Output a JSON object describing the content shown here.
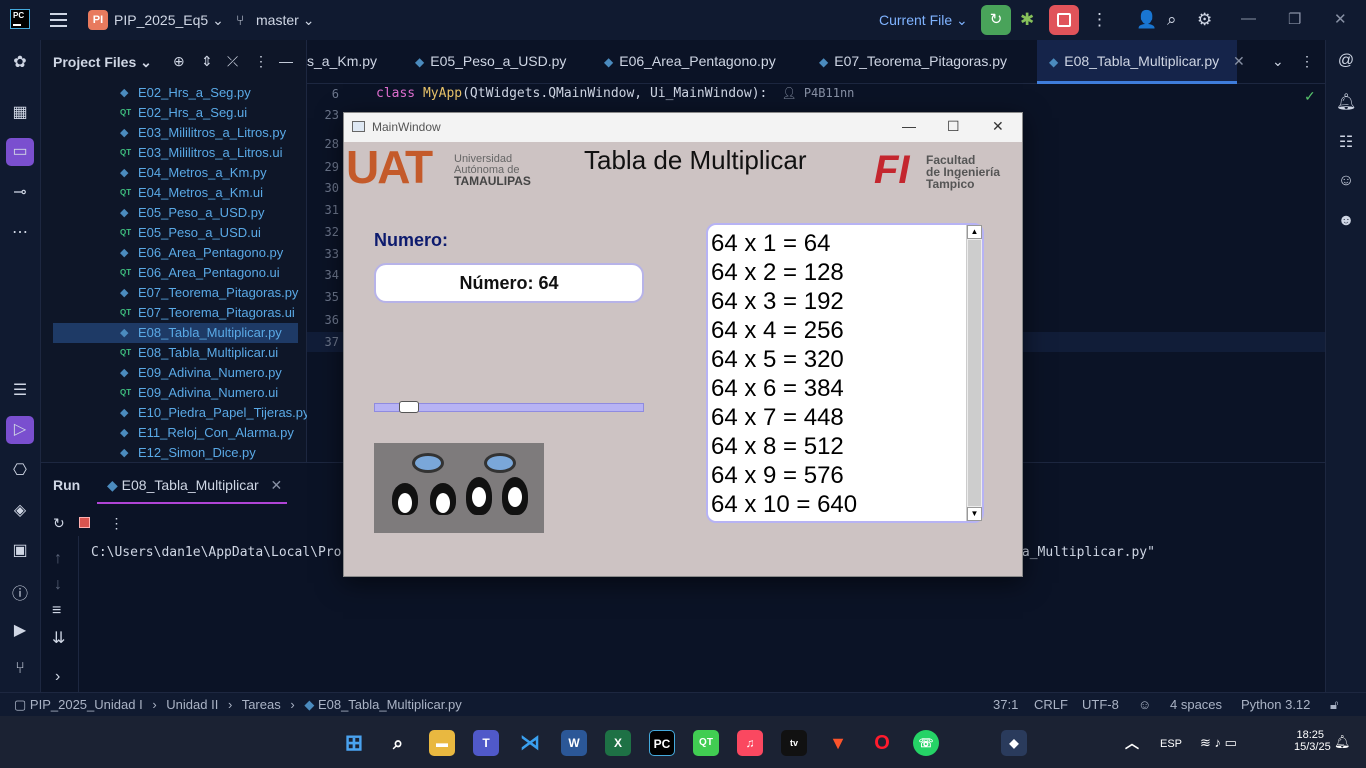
{
  "titlebar": {
    "logo": "PC",
    "project_badge": "PI",
    "project_name": "PIP_2025_Eq5",
    "branch": "master",
    "current_file": "Current File"
  },
  "project_panel": {
    "title": "Project Files",
    "files": [
      {
        "name": "E02_Hrs_a_Seg.py",
        "type": "py"
      },
      {
        "name": "E02_Hrs_a_Seg.ui",
        "type": "ui"
      },
      {
        "name": "E03_Mililitros_a_Litros.py",
        "type": "py"
      },
      {
        "name": "E03_Mililitros_a_Litros.ui",
        "type": "ui"
      },
      {
        "name": "E04_Metros_a_Km.py",
        "type": "py"
      },
      {
        "name": "E04_Metros_a_Km.ui",
        "type": "ui"
      },
      {
        "name": "E05_Peso_a_USD.py",
        "type": "py"
      },
      {
        "name": "E05_Peso_a_USD.ui",
        "type": "ui"
      },
      {
        "name": "E06_Area_Pentagono.py",
        "type": "py"
      },
      {
        "name": "E06_Area_Pentagono.ui",
        "type": "ui"
      },
      {
        "name": "E07_Teorema_Pitagoras.py",
        "type": "py"
      },
      {
        "name": "E07_Teorema_Pitagoras.ui",
        "type": "ui"
      },
      {
        "name": "E08_Tabla_Multiplicar.py",
        "type": "py",
        "selected": true
      },
      {
        "name": "E08_Tabla_Multiplicar.ui",
        "type": "ui"
      },
      {
        "name": "E09_Adivina_Numero.py",
        "type": "py"
      },
      {
        "name": "E09_Adivina_Numero.ui",
        "type": "ui"
      },
      {
        "name": "E10_Piedra_Papel_Tijeras.py",
        "type": "py"
      },
      {
        "name": "E11_Reloj_Con_Alarma.py",
        "type": "py"
      },
      {
        "name": "E12_Simon_Dice.py",
        "type": "py"
      }
    ]
  },
  "editor": {
    "tabs": [
      "s_a_Km.py",
      "E05_Peso_a_USD.py",
      "E06_Area_Pentagono.py",
      "E07_Teorema_Pitagoras.py",
      "E08_Tabla_Multiplicar.py"
    ],
    "line_numbers": [
      "6",
      "23",
      "28",
      "29",
      "30",
      "31",
      "32",
      "33",
      "34",
      "35",
      "36",
      "37"
    ],
    "code_kw": "class",
    "code_cls": "MyApp",
    "code_rest": "(QtWidgets.QMainWindow, Ui_MainWindow):",
    "author": "P4B11nn"
  },
  "run_panel": {
    "title": "Run",
    "tab": "E08_Tabla_Multiplicar",
    "console_left": "C:\\Users\\dan1e\\AppData\\Local\\Pro",
    "console_right": "\\E08_Tabla_Multiplicar.py\""
  },
  "statusbar": {
    "breadcrumb": [
      "PIP_2025_Unidad I",
      "Unidad II",
      "Tareas",
      "E08_Tabla_Multiplicar.py"
    ],
    "position": "37:1",
    "line_sep": "CRLF",
    "encoding": "UTF-8",
    "indent": "4 spaces",
    "interpreter": "Python 3.12"
  },
  "taskbar": {
    "lang": "ESP",
    "time": "18:25",
    "date": "15/3/25"
  },
  "qt_window": {
    "title": "MainWindow",
    "heading": "Tabla de Multiplicar",
    "uat_big": "UAT",
    "uat_line1": "Universidad",
    "uat_line2": "Autónoma de",
    "uat_line3": "TAMAULIPAS",
    "fi_mark": "FI",
    "fi_line1": "Facultad",
    "fi_line2": "de Ingeniería",
    "fi_line3": "Tampico",
    "label": "Numero:",
    "number_display": "Número: 64",
    "slider_value_fraction": 0.1,
    "table": [
      "64 x 1 = 64",
      "64 x 2 = 128",
      "64 x 3 = 192",
      "64 x 4 = 256",
      "64 x 5 = 320",
      "64 x 6 = 384",
      "64 x 7 = 448",
      "64 x 8 = 512",
      "64 x 9 = 576",
      "64 x 10 = 640"
    ]
  }
}
